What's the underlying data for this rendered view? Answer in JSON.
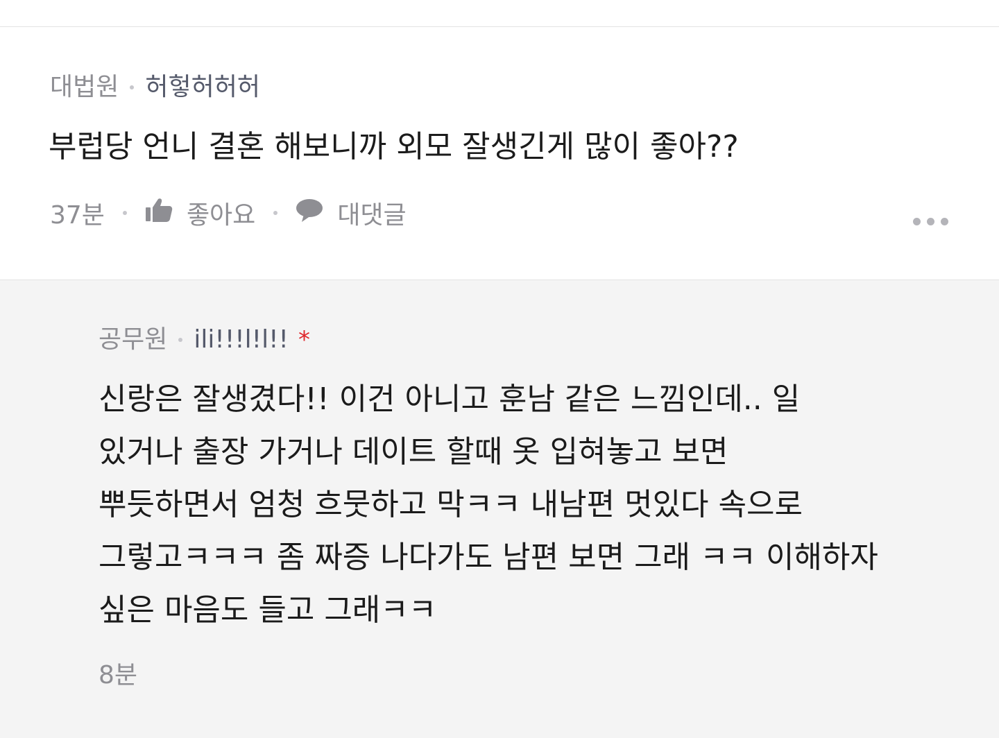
{
  "comment": {
    "author_job": "대법원",
    "author_nick": "허헣허허허",
    "text": "부럽당 언니 결혼 해보니까 외모 잘생긴게 많이 좋아??",
    "time": "37분",
    "like_label": "좋아요",
    "reply_label": "대댓글",
    "icons": {
      "like": "thumbs-up-icon",
      "reply": "speech-bubble-icon",
      "more": "more-dots-icon"
    }
  },
  "reply": {
    "author_job": "공무원",
    "author_nick": "ili!!!l!l!!",
    "author_badge": "*",
    "text_lines": [
      "신랑은 잘생겼다!! 이건 아니고 훈남 같은 느낌인데.. 일",
      "있거나 출장 가거나 데이트 할때 옷 입혀놓고 보면",
      "뿌듯하면서 엄청 흐뭇하고 막ㅋㅋ 내남편 멋있다 속으로",
      "그렇고ㅋㅋㅋ 좀 짜증 나다가도 남편 보면 그래 ㅋㅋ 이해하자",
      "싶은 마음도 들고 그래ㅋㅋ"
    ],
    "time": "8분"
  },
  "colors": {
    "text_primary": "#1b1b1b",
    "text_secondary": "#8e8e93",
    "nickname": "#555a6b",
    "badge_red": "#e0282d",
    "reply_bg": "#f4f4f4"
  }
}
